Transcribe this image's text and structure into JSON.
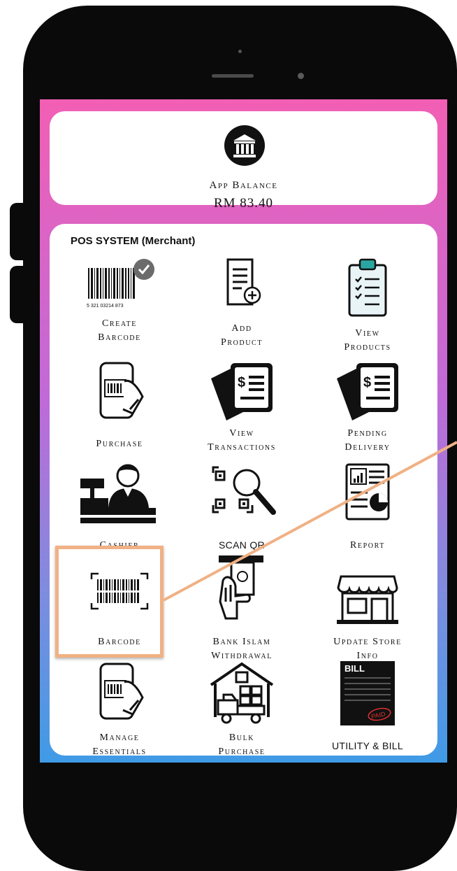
{
  "balance": {
    "label": "App Balance",
    "value": "RM 83.40",
    "icon": "bank-icon"
  },
  "pos": {
    "title": "POS SYSTEM (Merchant)",
    "items": [
      {
        "id": "create-barcode",
        "line1": "Create",
        "line2": "Barcode",
        "icon": "barcode-check-icon",
        "barcode_digits": "5 321 03214 873"
      },
      {
        "id": "add-product",
        "line1": "Add",
        "line2": "Product",
        "icon": "document-add-icon"
      },
      {
        "id": "view-products",
        "line1": "View",
        "line2": "Products",
        "icon": "clipboard-checklist-icon"
      },
      {
        "id": "purchase",
        "line1": "Purchase",
        "line2": "",
        "icon": "phone-scan-icon"
      },
      {
        "id": "view-transactions",
        "line1": "View",
        "line2": "Transactions",
        "icon": "invoice-stack-icon"
      },
      {
        "id": "pending-delivery",
        "line1": "Pending",
        "line2": "Delivery",
        "icon": "invoice-stack-icon"
      },
      {
        "id": "cashier",
        "line1": "Cashier",
        "line2": "",
        "icon": "cashier-icon"
      },
      {
        "id": "scan-qr",
        "line1": "SCAN QR",
        "line2": "",
        "icon": "qr-search-icon"
      },
      {
        "id": "report",
        "line1": "Report",
        "line2": "",
        "icon": "report-chart-icon"
      },
      {
        "id": "barcode",
        "line1": "Barcode",
        "line2": "",
        "icon": "barcode-scan-icon"
      },
      {
        "id": "bank-islam-withdrawal",
        "line1": "Bank Islam",
        "line2": "Withdrawal",
        "icon": "atm-withdrawal-icon"
      },
      {
        "id": "update-store-info",
        "line1": "Update Store",
        "line2": "Info",
        "icon": "storefront-icon"
      },
      {
        "id": "manage-essentials",
        "line1": "Manage",
        "line2": "Essentials",
        "icon": "phone-scan-icon"
      },
      {
        "id": "bulk-purchase",
        "line1": "Bulk",
        "line2": "Purchase",
        "icon": "warehouse-truck-icon"
      },
      {
        "id": "utility-bill",
        "line1": "UTILITY & BILL",
        "line2": "",
        "icon": "bill-paid-icon",
        "bill_header": "BILL",
        "stamp": "PAID"
      }
    ]
  },
  "colors": {
    "gradient_top": "#f25fb4",
    "gradient_bottom": "#3f9be6",
    "highlight": "#f0b184",
    "icon_teal": "#2aa6a0"
  }
}
